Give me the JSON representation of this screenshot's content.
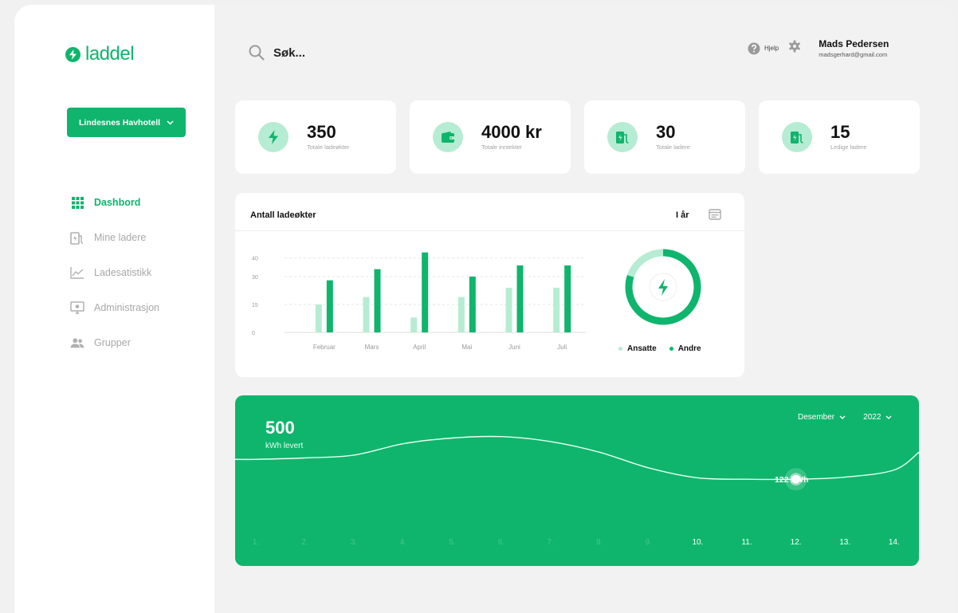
{
  "brand": {
    "name": "laddel",
    "accent": "#0fb56c",
    "accent_light": "#b6ecd3"
  },
  "sidebar": {
    "location": "Lindesnes Havhotell",
    "items": [
      {
        "label": "Dashbord",
        "icon": "grid-icon",
        "active": true
      },
      {
        "label": "Mine ladere",
        "icon": "charger-icon",
        "active": false
      },
      {
        "label": "Ladesatistikk",
        "icon": "line-chart-icon",
        "active": false
      },
      {
        "label": "Administrasjon",
        "icon": "monitor-icon",
        "active": false
      },
      {
        "label": "Grupper",
        "icon": "users-icon",
        "active": false
      }
    ]
  },
  "header": {
    "search_placeholder": "Søk...",
    "help_label": "Hjelp",
    "user_name": "Mads Pedersen",
    "user_email": "madsgerhard@gmail.com"
  },
  "stats": [
    {
      "value": "350",
      "label": "Totale ladeøkter",
      "icon": "bolt-icon"
    },
    {
      "value": "4000 kr",
      "label": "Totale inntekter",
      "icon": "wallet-icon"
    },
    {
      "value": "30",
      "label": "Totale ladere",
      "icon": "charger-icon"
    },
    {
      "value": "15",
      "label": "Ledige ladere",
      "icon": "charger-icon"
    }
  ],
  "sessions": {
    "title": "Antall ladeøkter",
    "period": "I år",
    "legend_ansatte": "Ansatte",
    "legend_andre": "Andre",
    "color_ansatte": "#b6ecd3",
    "color_andre": "#0fb56c",
    "donut_andre_fraction": 0.8
  },
  "chart_data": [
    {
      "type": "bar",
      "categories": [
        "Februar",
        "Mars",
        "April",
        "Mai",
        "Juni",
        "Juli"
      ],
      "series": [
        {
          "name": "Ansatte",
          "values": [
            15,
            19,
            8,
            19,
            24,
            24
          ]
        },
        {
          "name": "Andre",
          "values": [
            28,
            34,
            43,
            30,
            36,
            36
          ]
        }
      ],
      "yticks": [
        0,
        15,
        30,
        40
      ],
      "ylim": [
        0,
        45
      ],
      "grid": true
    },
    {
      "type": "line",
      "x": [
        "1.",
        "2.",
        "3.",
        "4.",
        "5.",
        "6.",
        "7.",
        "8.",
        "9.",
        "10.",
        "11.",
        "12.",
        "13.",
        "14."
      ],
      "values": [
        150,
        152,
        156,
        172,
        180,
        182,
        175,
        160,
        138,
        124,
        122,
        122,
        125,
        135
      ],
      "highlight_index": 11,
      "highlight_label": "122 kWh",
      "ylim": [
        0,
        240
      ]
    }
  ],
  "energy": {
    "value": "500",
    "label": "kWh levert",
    "month": "Desember",
    "year": "2022"
  }
}
